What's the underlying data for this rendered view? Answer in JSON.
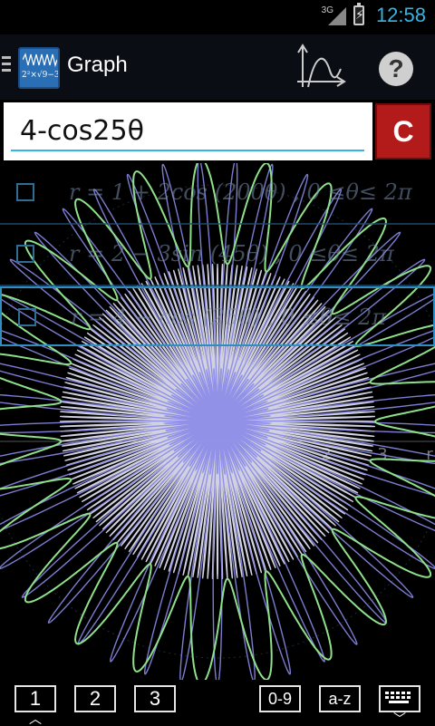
{
  "status_bar": {
    "network": "3G",
    "battery": "⚡",
    "time": "12:58"
  },
  "action_bar": {
    "app_title": "Graph",
    "app_icon_formula": "2²×√9−3/2",
    "menu_icon": "hamburger-icon",
    "axes_icon": "axes-icon",
    "help_label": "?"
  },
  "input": {
    "value": "4-cos25θ",
    "clear_label": "C"
  },
  "functions": [
    {
      "expression": "r = 1 + 2cos (200θ) ,  0  ≤θ≤  2π",
      "selected": false
    },
    {
      "expression": "r = 2 − 3sin (45θ) ,  0  ≤θ≤  2π",
      "selected": false
    },
    {
      "expression": "r = 4 − cos (25θ) ,  0  ≤θ≤  2π",
      "selected": true
    }
  ],
  "axis_ticks": [
    "2",
    "3",
    "r"
  ],
  "colors": {
    "accent": "#33b5e5",
    "clear_button": "#b31b1b",
    "curve_green": "#8fe08a",
    "curve_blue": "#8a8ae8",
    "curve_white": "#e8e8f8"
  },
  "keyboard_bar": {
    "buttons": [
      {
        "label": "1",
        "has_caret": true
      },
      {
        "label": "2",
        "has_caret": false
      },
      {
        "label": "3",
        "has_caret": false
      },
      {
        "label": "0-9",
        "has_caret": false
      },
      {
        "label": "a-z",
        "has_caret": false
      },
      {
        "label": "",
        "has_caret": true
      }
    ]
  }
}
